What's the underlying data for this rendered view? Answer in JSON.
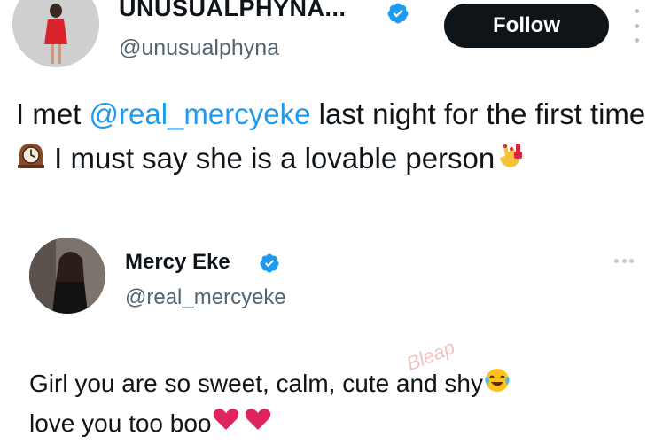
{
  "tweet": {
    "display_name": "UNUSUALPHYNA...",
    "handle": "@unusualphyna",
    "follow_label": "Follow",
    "text_before": "I met ",
    "mention": "@real_mercyeke",
    "text_mid": " last night for the first time ",
    "text_after": " I must say she is a lovable person",
    "emoji_1": "mantelpiece-clock",
    "emoji_2": "nail-polish"
  },
  "quoted_tweet": {
    "display_name": "Mercy Eke",
    "handle": "@real_mercyeke",
    "line1": "Girl you are so sweet, calm, cute and shy",
    "line2": "love you too boo",
    "emoji_laugh": "face-with-tears-of-joy",
    "emoji_hearts": "red-heart"
  },
  "watermark": "Bleap",
  "colors": {
    "mention_blue": "#1d9bf0",
    "verified_blue": "#1d9bf0",
    "follow_bg": "#0f1419",
    "handle_gray": "#536471",
    "heart_red": "#e0245e"
  }
}
